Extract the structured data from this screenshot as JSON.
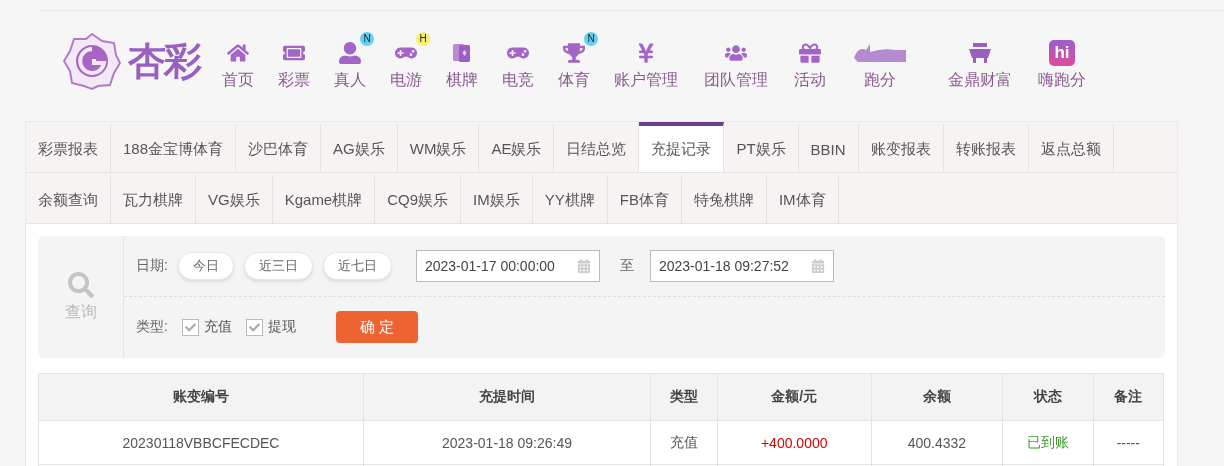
{
  "logo": {
    "text": "杏彩"
  },
  "nav": [
    {
      "label": "首页"
    },
    {
      "label": "彩票"
    },
    {
      "label": "真人",
      "badge": "N"
    },
    {
      "label": "电游",
      "badge": "H"
    },
    {
      "label": "棋牌"
    },
    {
      "label": "电竞"
    },
    {
      "label": "体育",
      "badge": "N"
    },
    {
      "label": "账户管理"
    },
    {
      "label": "团队管理"
    },
    {
      "label": "活动"
    },
    {
      "label": "跑分"
    },
    {
      "label": "金鼎财富"
    },
    {
      "label": "嗨跑分",
      "icon_text": "hi"
    }
  ],
  "tab_rows": [
    [
      {
        "label": "彩票报表",
        "selected": false
      },
      {
        "label": "188金宝博体育",
        "selected": false
      },
      {
        "label": "沙巴体育",
        "selected": false
      },
      {
        "label": "AG娱乐",
        "selected": false
      },
      {
        "label": "WM娱乐",
        "selected": false
      },
      {
        "label": "AE娱乐",
        "selected": false
      },
      {
        "label": "日结总览",
        "selected": false
      },
      {
        "label": "充提记录",
        "selected": true
      },
      {
        "label": "PT娱乐",
        "selected": false
      },
      {
        "label": "BBIN",
        "selected": false
      },
      {
        "label": "账变报表",
        "selected": false
      },
      {
        "label": "转账报表",
        "selected": false
      },
      {
        "label": "返点总额",
        "selected": false
      }
    ],
    [
      {
        "label": "余额查询",
        "selected": false
      },
      {
        "label": "瓦力棋牌",
        "selected": false
      },
      {
        "label": "VG娱乐",
        "selected": false
      },
      {
        "label": "Kgame棋牌",
        "selected": false
      },
      {
        "label": "CQ9娱乐",
        "selected": false
      },
      {
        "label": "IM娱乐",
        "selected": false
      },
      {
        "label": "YY棋牌",
        "selected": false
      },
      {
        "label": "FB体育",
        "selected": false
      },
      {
        "label": "特兔棋牌",
        "selected": false
      },
      {
        "label": "IM体育",
        "selected": false
      }
    ]
  ],
  "query": {
    "label": "查询",
    "date_label": "日期:",
    "quick_ranges": [
      "今日",
      "近三日",
      "近七日"
    ],
    "start": "2023-01-17 00:00:00",
    "separator": "至",
    "end": "2023-01-18 09:27:52",
    "type_label": "类型:",
    "types": [
      {
        "label": "充值",
        "checked": true
      },
      {
        "label": "提现",
        "checked": true
      }
    ],
    "confirm": "确 定"
  },
  "table": {
    "columns": [
      "账变编号",
      "充提时间",
      "类型",
      "金额/元",
      "余额",
      "状态",
      "备注"
    ],
    "rows": [
      [
        "20230118VBBCFECDEC",
        "2023-01-18 09:26:49",
        "充值",
        "+400.0000",
        "400.4332",
        "已到账",
        "-----"
      ]
    ]
  }
}
